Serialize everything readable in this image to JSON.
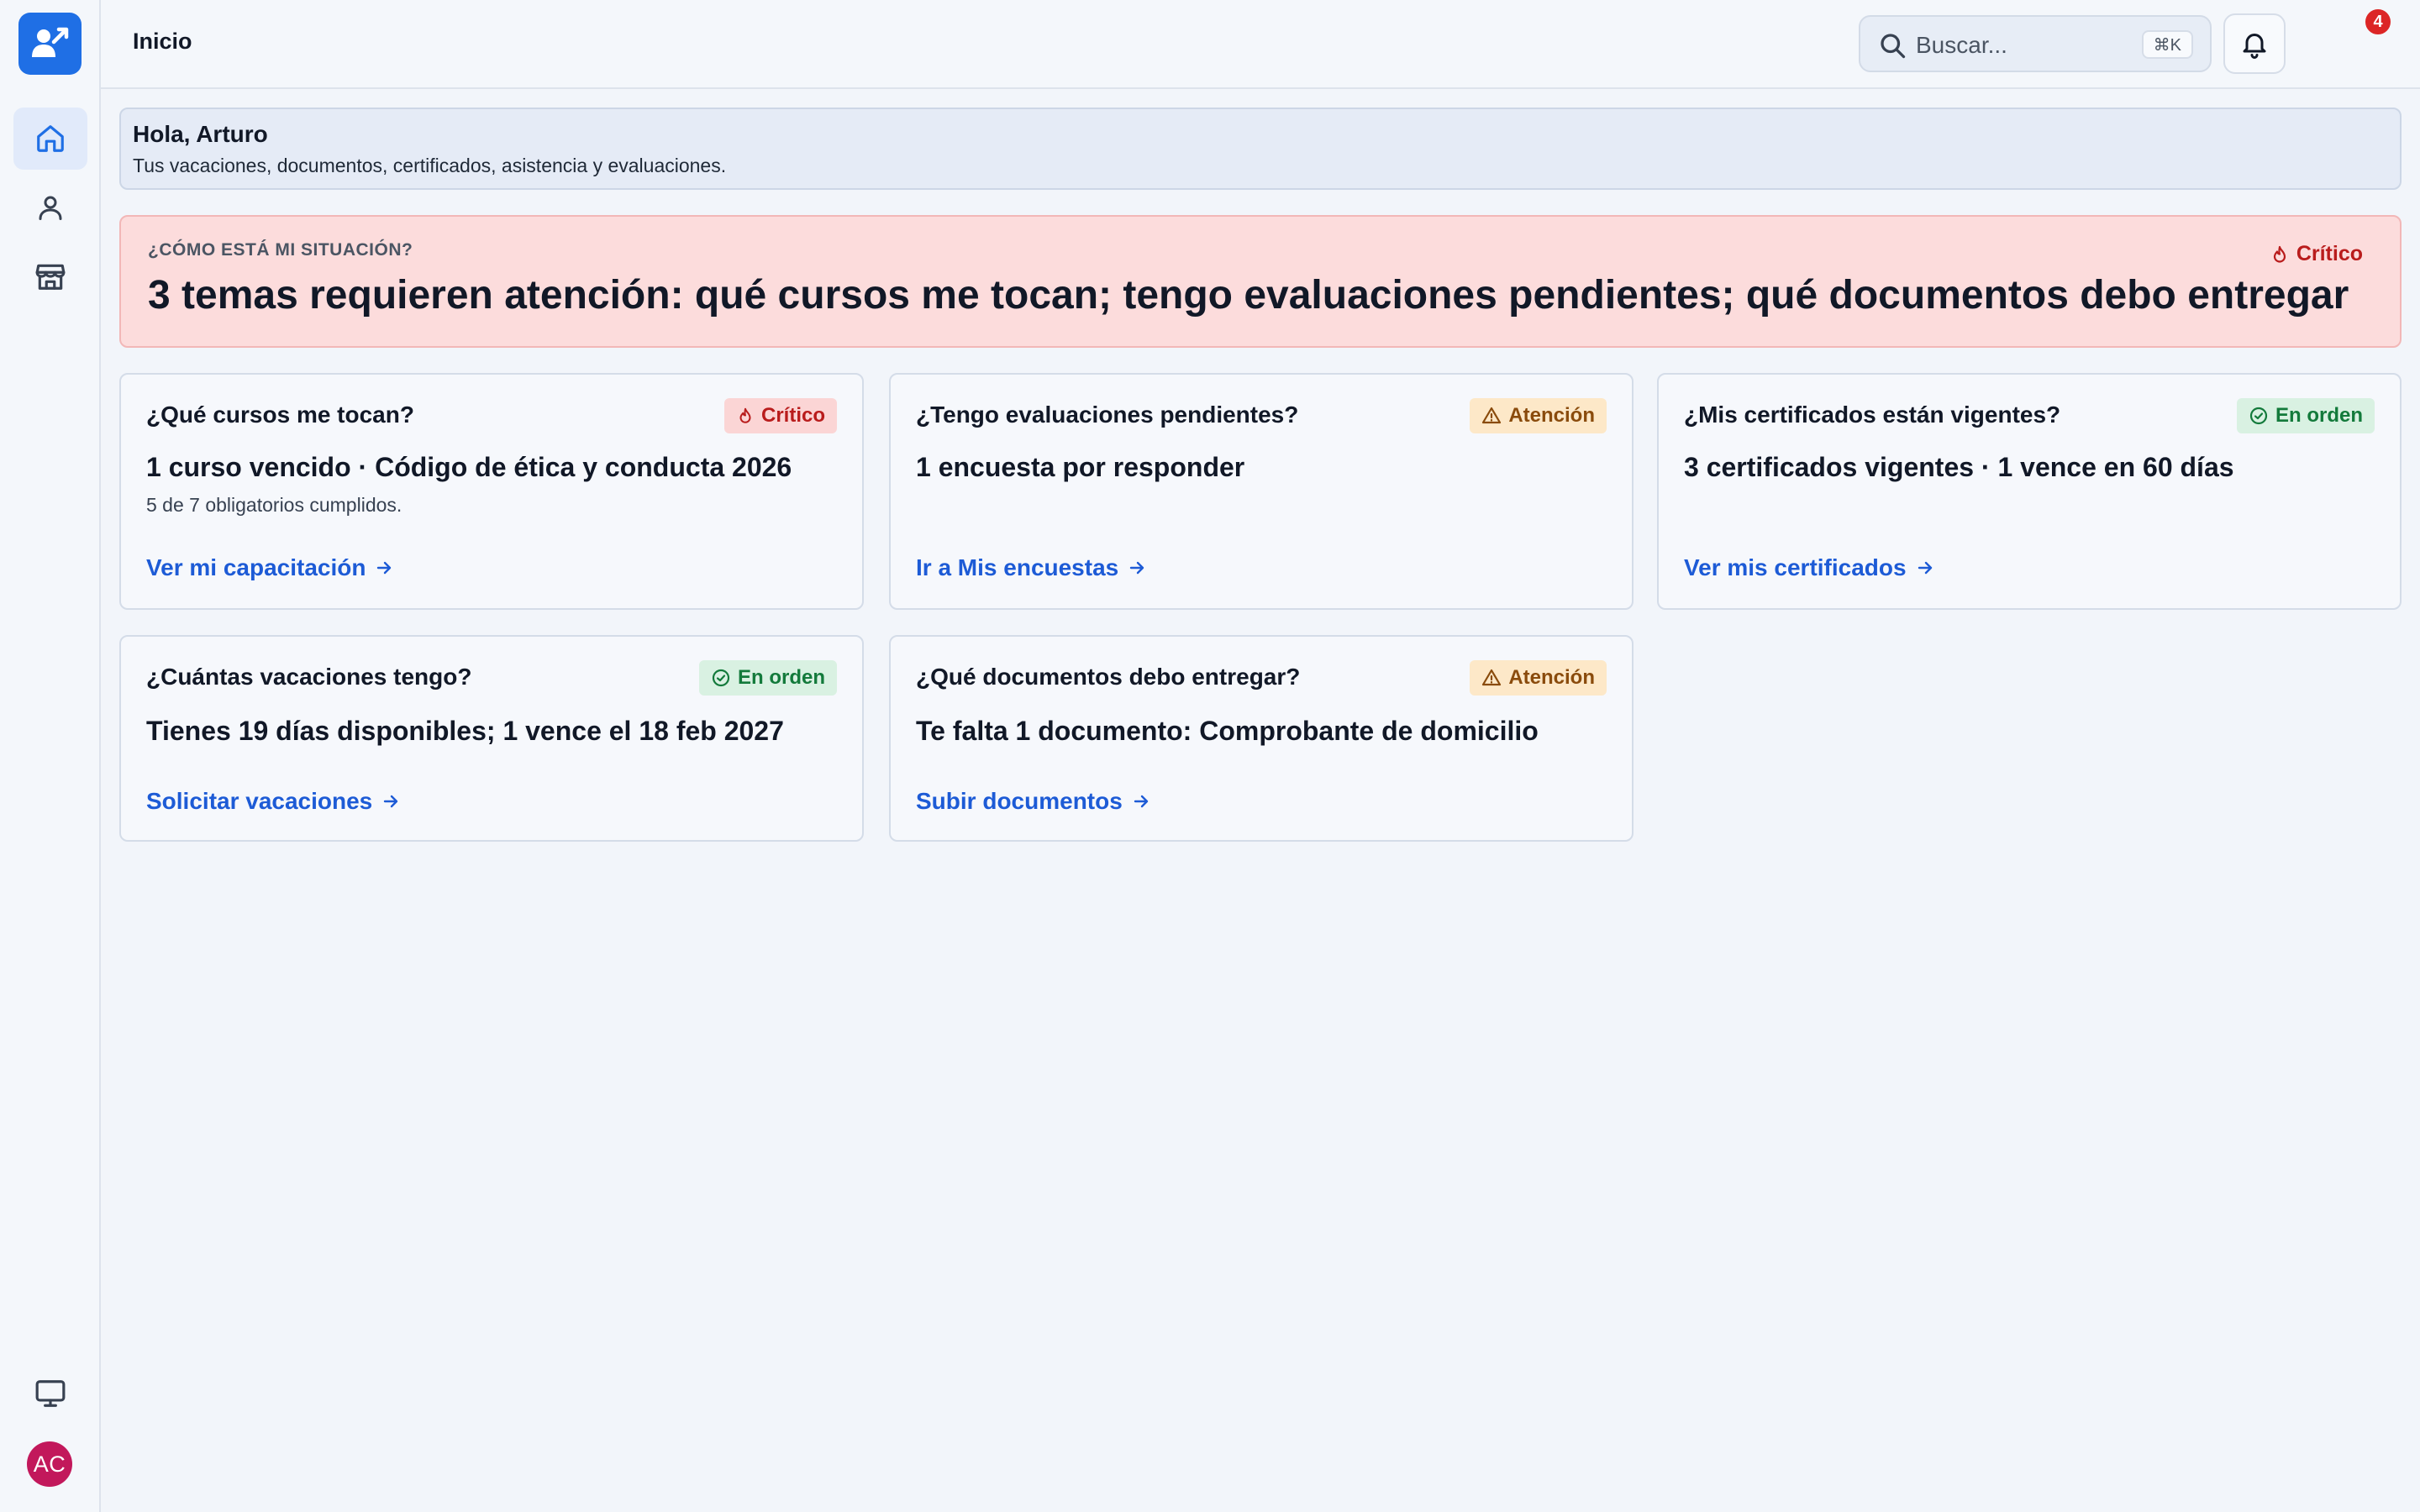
{
  "header": {
    "title": "Inicio",
    "search_placeholder": "Buscar...",
    "search_shortcut": "⌘K",
    "notifications_count": "4"
  },
  "sidebar": {
    "items": [
      {
        "name": "home",
        "icon": "home-icon"
      },
      {
        "name": "profile",
        "icon": "user-icon"
      },
      {
        "name": "store",
        "icon": "store-icon"
      }
    ],
    "bottom": {
      "icon": "monitor-icon"
    },
    "user_initials": "AC",
    "avatar_color": "#c2185b"
  },
  "greeting": {
    "title": "Hola, Arturo",
    "subtitle": "Tus vacaciones, documentos, certificados, asistencia y evaluaciones."
  },
  "alert": {
    "eyebrow": "¿CÓMO ESTÁ MI SITUACIÓN?",
    "title": "3 temas requieren atención: qué cursos me tocan; tengo evaluaciones pendientes; qué documentos debo entregar",
    "status": "Crítico"
  },
  "cards": [
    {
      "question": "¿Qué cursos me tocan?",
      "status": "Crítico",
      "main": "1 curso vencido · Código de ética y conducta 2026",
      "sub": "5 de 7 obligatorios cumplidos.",
      "link": "Ver mi capacitación"
    },
    {
      "question": "¿Tengo evaluaciones pendientes?",
      "status": "Atención",
      "main": "1 encuesta por responder",
      "link": "Ir a Mis encuestas"
    },
    {
      "question": "¿Mis certificados están vigentes?",
      "status": "En orden",
      "main": "3 certificados vigentes · 1 vence en 60 días",
      "link": "Ver mis certificados"
    },
    {
      "question": "¿Cuántas vacaciones tengo?",
      "status": "En orden",
      "main": "Tienes 19 días disponibles; 1 vence el 18 feb 2027",
      "link": "Solicitar vacaciones"
    },
    {
      "question": "¿Qué documentos debo entregar?",
      "status": "Atención",
      "main": "Te falta 1 documento: Comprobante de domicilio",
      "link": "Subir documentos"
    }
  ],
  "colors": {
    "accent": "#1f6fe5",
    "link": "#1d5bd6",
    "critical": "#b91c1c",
    "warning": "#8a4b0c",
    "ok": "#137a3b"
  }
}
